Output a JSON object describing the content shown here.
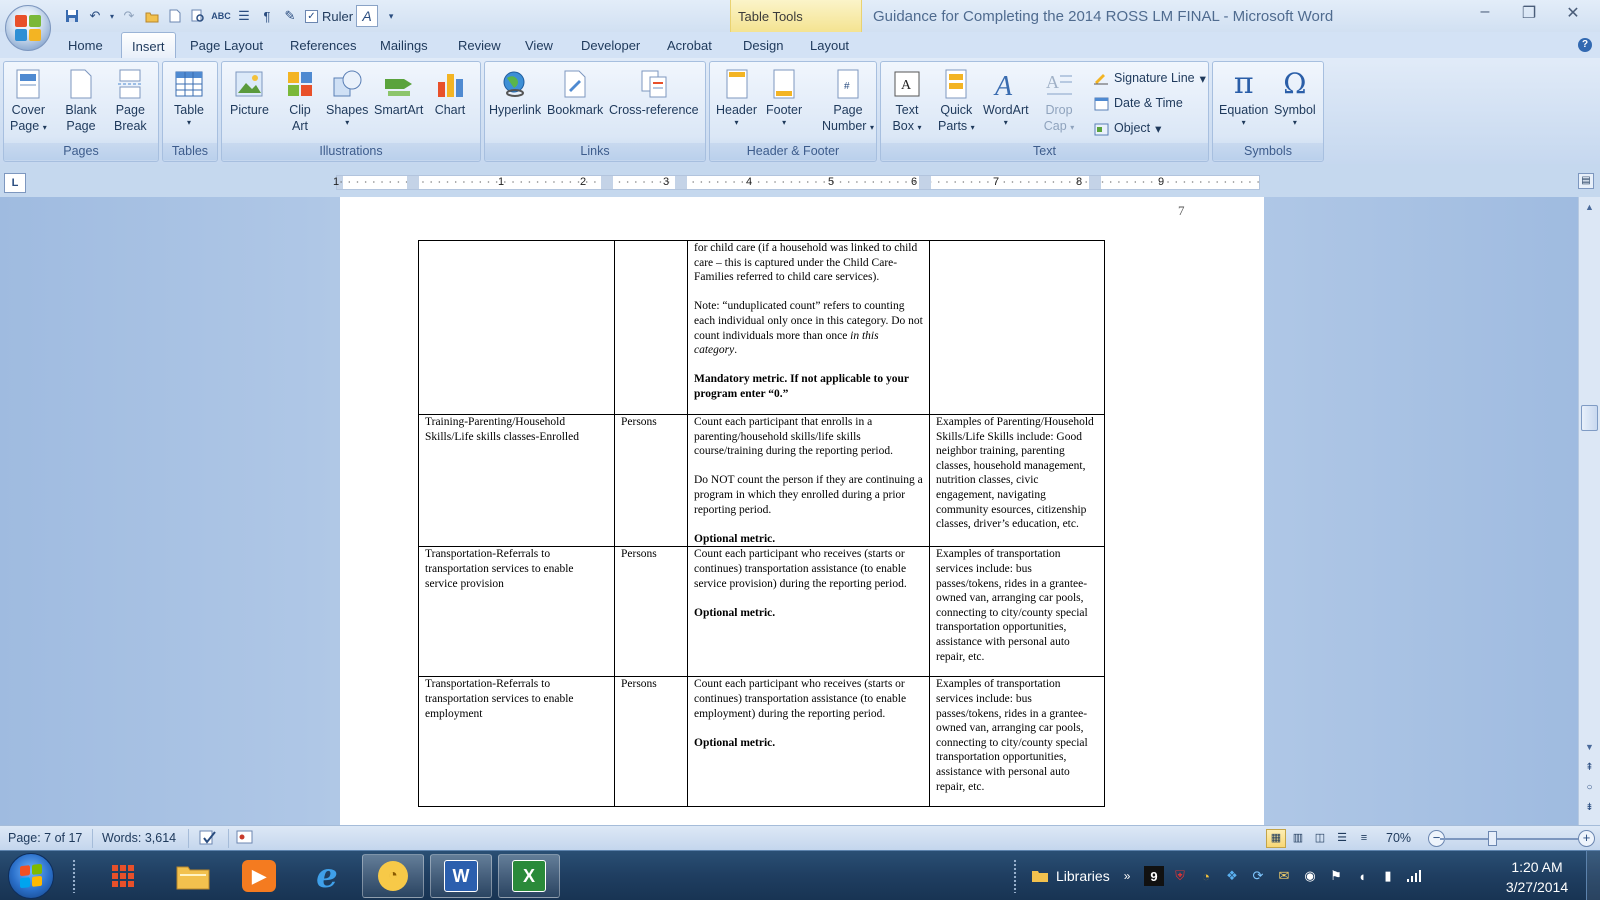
{
  "window": {
    "title": "Guidance for Completing the 2014 ROSS LM FINAL - Microsoft Word",
    "context_tab_group": "Table Tools",
    "minimize": "–",
    "restore": "❐",
    "close": "✕"
  },
  "quick_access": {
    "ruler_label": "Ruler"
  },
  "tabs": [
    "Home",
    "Insert",
    "Page Layout",
    "References",
    "Mailings",
    "Review",
    "View",
    "Developer",
    "Acrobat",
    "Design",
    "Layout"
  ],
  "active_tab": "Insert",
  "ribbon": {
    "groups": {
      "pages": "Pages",
      "tables": "Tables",
      "illustrations": "Illustrations",
      "links": "Links",
      "header_footer": "Header & Footer",
      "text": "Text",
      "symbols": "Symbols"
    },
    "buttons": {
      "cover_page_1": "Cover",
      "cover_page_2": "Page",
      "blank_page_1": "Blank",
      "blank_page_2": "Page",
      "page_break_1": "Page",
      "page_break_2": "Break",
      "table": "Table",
      "picture": "Picture",
      "clip_art_1": "Clip",
      "clip_art_2": "Art",
      "shapes": "Shapes",
      "smartart": "SmartArt",
      "chart": "Chart",
      "hyperlink": "Hyperlink",
      "bookmark": "Bookmark",
      "cross_reference": "Cross-reference",
      "header": "Header",
      "footer": "Footer",
      "page_number_1": "Page",
      "page_number_2": "Number",
      "text_box_1": "Text",
      "text_box_2": "Box",
      "quick_parts_1": "Quick",
      "quick_parts_2": "Parts",
      "wordart": "WordArt",
      "drop_cap_1": "Drop",
      "drop_cap_2": "Cap",
      "signature_line": "Signature Line",
      "date_time": "Date & Time",
      "object": "Object",
      "equation": "Equation",
      "symbol": "Symbol"
    }
  },
  "ruler": {
    "numbers": [
      "1",
      "1",
      "2",
      "3",
      "4",
      "5",
      "6",
      "7",
      "8",
      "9"
    ]
  },
  "document": {
    "page_number": "7",
    "row1": {
      "col3_p1": "for child care (if a household was linked to child care – this is  captured under the Child Care-Families referred to child care services).",
      "col3_p2_a": "Note: “unduplicated count” refers to counting each individual only once in this category.  Do not count individuals more than once ",
      "col3_p2_italic": "in this category",
      "col3_p2_end": ".",
      "col3_p3": "Mandatory metric. If not applicable to your program enter “0.”"
    },
    "row2": {
      "col1": "Training-Parenting/Household Skills/Life skills  classes-Enrolled",
      "col2": "Persons",
      "col3_p1": "Count each participant that enrolls in a parenting/household skills/life skills course/training during the reporting period.",
      "col3_p2": "Do NOT count the person if they are continuing a program in which they enrolled during a prior reporting period.",
      "col3_p3": "Optional metric.",
      "col4": "Examples of Parenting/Household Skills/Life Skills include:  Good neighbor training, parenting classes, household management, nutrition classes, civic engagement, navigating community esources, citizenship classes, driver’s education, etc."
    },
    "row3": {
      "col1": "Transportation-Referrals to transportation services to enable service provision",
      "col2": "Persons",
      "col3_p1": "Count each participant who receives (starts or continues) transportation assistance (to enable service provision) during the reporting period.",
      "col3_p2": "Optional metric.",
      "col4": "Examples of transportation services include: bus passes/tokens, rides in a grantee-owned van, arranging car pools, connecting to city/county special transportation opportunities, assistance with personal auto repair, etc."
    },
    "row4": {
      "col1": "Transportation-Referrals to transportation services to enable employment",
      "col2": "Persons",
      "col3_p1": "Count each participant who receives (starts or continues) transportation assistance (to enable employment) during the reporting period.",
      "col3_p2": "Optional metric.",
      "col4": "Examples of transportation services include: bus passes/tokens, rides in a grantee-owned van, arranging car pools, connecting to city/county special transportation opportunities, assistance with personal auto repair, etc."
    }
  },
  "status": {
    "page": "Page: 7 of 17",
    "words": "Words: 3,614",
    "zoom": "70%"
  },
  "taskbar": {
    "libraries": "Libraries",
    "time": "1:20 AM",
    "date": "3/27/2014",
    "badge": "9"
  },
  "colors": {
    "ribbon_bg": "#dbe7f6",
    "accent": "#1e395b",
    "table_tools": "#f4e391",
    "taskbar": "#1f3e61"
  }
}
